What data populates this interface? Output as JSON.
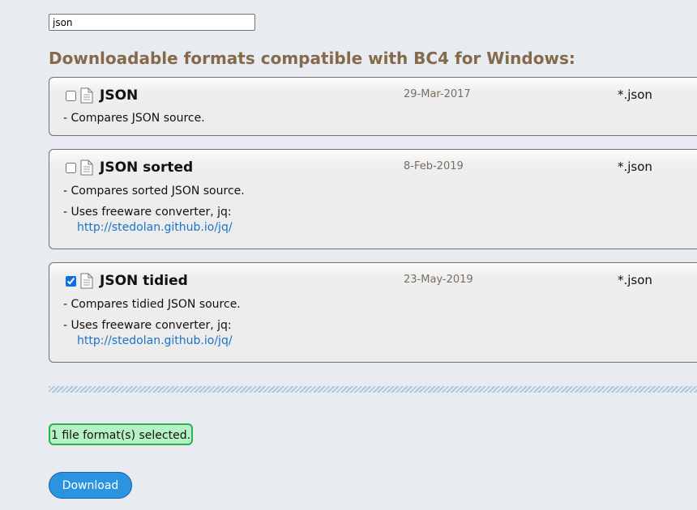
{
  "search": {
    "value": "json",
    "placeholder": ""
  },
  "heading": "Downloadable formats compatible with BC4 for Windows:",
  "icons": {
    "file": "document-icon"
  },
  "colors": {
    "heading": "#846a4a",
    "link": "#1a73c8",
    "status_bg": "#b5f1c4",
    "status_border": "#2db052",
    "button": "#2b93e0"
  },
  "formats": [
    {
      "name": "JSON",
      "date": "29-Mar-2017",
      "ext": "*.json",
      "checked": false,
      "lines": [
        "- Compares JSON source."
      ],
      "link": ""
    },
    {
      "name": "JSON sorted",
      "date": "8-Feb-2019",
      "ext": "*.json",
      "checked": false,
      "lines": [
        "- Compares sorted JSON source.",
        "- Uses freeware converter, jq:"
      ],
      "link": "http://stedolan.github.io/jq/"
    },
    {
      "name": "JSON tidied",
      "date": "23-May-2019",
      "ext": "*.json",
      "checked": true,
      "lines": [
        "- Compares tidied JSON source.",
        "- Uses freeware converter, jq:"
      ],
      "link": "http://stedolan.github.io/jq/"
    }
  ],
  "status": "1 file format(s) selected.",
  "download_label": "Download"
}
